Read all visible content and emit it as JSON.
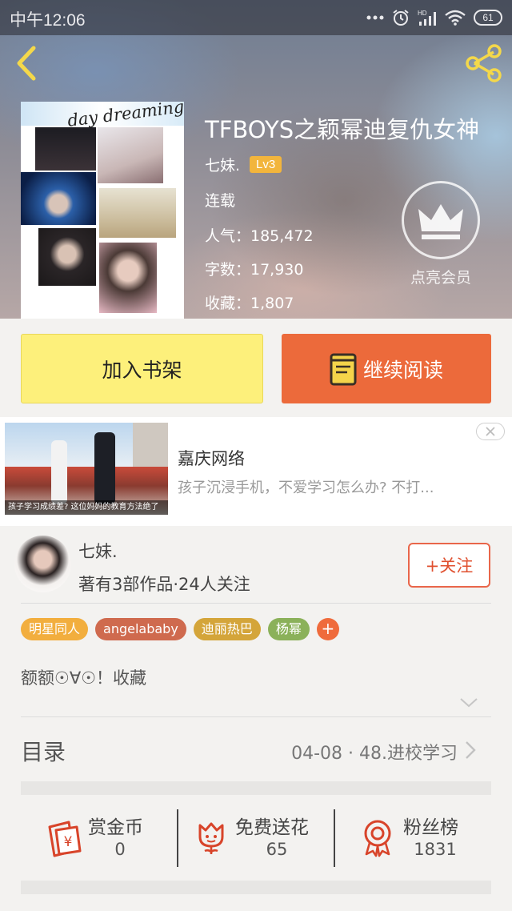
{
  "status_bar": {
    "time": "中午12:06",
    "battery": "61"
  },
  "book": {
    "title": "TFBOYS之颖幂迪复仇女神",
    "author": "七妹.",
    "level": "Lv3",
    "status": "连载",
    "popularity": "人气：185,472",
    "word_count": "字数：17,930",
    "favorites": "收藏：1,807",
    "cover_title": "day dreaming",
    "vip_label": "点亮会员"
  },
  "actions": {
    "add_to_shelf": "加入书架",
    "continue_reading": "继续阅读"
  },
  "ad": {
    "title": "嘉庆网络",
    "description": "孩子沉浸手机，不爱学习怎么办? 不打...",
    "image_caption": "孩子学习成绩差? 这位妈妈的教育方法绝了"
  },
  "author_info": {
    "name": "七妹.",
    "stats": "著有3部作品·24人关注",
    "follow_label": "+关注"
  },
  "tags": [
    {
      "label": "明星同人",
      "color": "#f2ae3e"
    },
    {
      "label": "angelababy",
      "color": "#cf6a4e"
    },
    {
      "label": "迪丽热巴",
      "color": "#d4a53a"
    },
    {
      "label": "杨幂",
      "color": "#8bb15a"
    }
  ],
  "summary": "额额☉∀☉！收藏",
  "toc": {
    "label": "目录",
    "latest": "04-08 · 48.进校学习"
  },
  "stats": [
    {
      "label": "赏金币",
      "value": "0",
      "icon": "red-envelope-icon"
    },
    {
      "label": "免费送花",
      "value": "65",
      "icon": "flower-icon"
    },
    {
      "label": "粉丝榜",
      "value": "1831",
      "icon": "medal-icon"
    }
  ],
  "colors": {
    "accent": "#ec6a3b",
    "shelf_button": "#fdf07b",
    "level_badge": "#f2b53c",
    "icon_red": "#d8442a"
  }
}
